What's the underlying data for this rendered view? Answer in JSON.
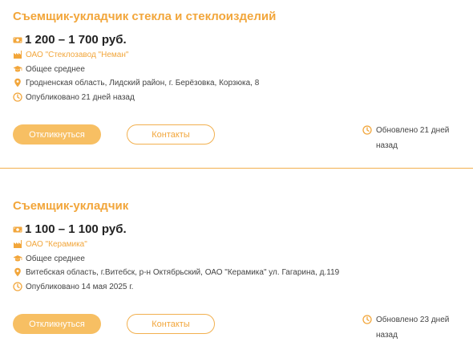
{
  "colors": {
    "accent": "#f2a63b",
    "button_fill": "#f7bf63",
    "divider": "#f2b04f",
    "text": "#444444"
  },
  "vacancies": [
    {
      "title": "Съемщик-укладчик стекла и стеклоизделий",
      "salary": "1 200 – 1 700 руб.",
      "company": "ОАО \"Стеклозавод \"Неман\"",
      "education": "Общее среднее",
      "location": "Гродненская область, Лидский район, г. Берёзовка, Корзюка, 8",
      "published": "Опубликовано 21 дней назад",
      "respond_label": "Откликнуться",
      "contacts_label": "Контакты",
      "updated": "Обновлено 21 дней назад"
    },
    {
      "title": "Съемщик-укладчик",
      "salary": "1 100 – 1 100 руб.",
      "company": "ОАО \"Керамика\"",
      "education": "Общее среднее",
      "location": "Витебская область, г.Витебск, р-н Октябрьский, ОАО \"Керамика\" ул. Гагарина, д.119",
      "published": "Опубликовано 14 мая 2025 г.",
      "respond_label": "Откликнуться",
      "contacts_label": "Контакты",
      "updated": "Обновлено 23 дней назад"
    }
  ],
  "icons": {
    "salary": "money-icon",
    "company": "factory-icon",
    "education": "graduation-cap-icon",
    "location": "map-pin-icon",
    "published": "clock-icon",
    "updated": "clock-icon"
  }
}
